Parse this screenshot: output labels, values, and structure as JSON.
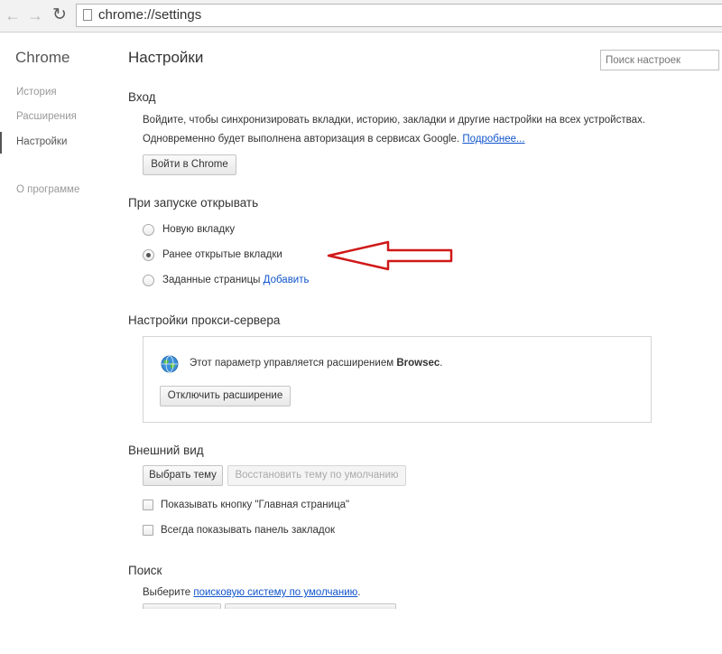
{
  "browser": {
    "url": "chrome://settings"
  },
  "sidebar": {
    "title": "Chrome",
    "items": [
      {
        "label": "История"
      },
      {
        "label": "Расширения"
      },
      {
        "label": "Настройки"
      },
      {
        "label": "О программе"
      }
    ]
  },
  "header": {
    "title": "Настройки",
    "search_placeholder": "Поиск настроек"
  },
  "signin": {
    "title": "Вход",
    "line1": "Войдите, чтобы синхронизировать вкладки, историю, закладки и другие настройки на всех устройствах.",
    "line2": "Одновременно будет выполнена авторизация в сервисах Google.",
    "more_link": "Подробнее...",
    "button": "Войти в Chrome"
  },
  "startup": {
    "title": "При запуске открывать",
    "options": [
      {
        "label": "Новую вкладку",
        "checked": false
      },
      {
        "label": "Ранее открытые вкладки",
        "checked": true
      },
      {
        "label": "Заданные страницы",
        "checked": false
      }
    ],
    "add_link": "Добавить"
  },
  "proxy": {
    "title": "Настройки прокси-сервера",
    "message": "Этот параметр управляется расширением",
    "extension": "Browsec",
    "button": "Отключить расширение"
  },
  "appearance": {
    "title": "Внешний вид",
    "theme_button": "Выбрать тему",
    "reset_button": "Восстановить тему по умолчанию",
    "checkboxes": [
      {
        "label": "Показывать кнопку \"Главная страница\"",
        "checked": false
      },
      {
        "label": "Всегда показывать панель закладок",
        "checked": false
      }
    ]
  },
  "search_section": {
    "title": "Поиск",
    "prefix": "Выберите",
    "link": "поисковую систему по умолчанию"
  },
  "colors": {
    "link": "#1155cc",
    "annotation_arrow": "#d01818"
  }
}
